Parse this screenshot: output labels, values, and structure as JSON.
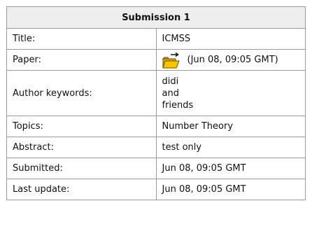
{
  "header": {
    "title": "Submission 1"
  },
  "rows": [
    {
      "label": "Title:",
      "value": "ICMSS"
    },
    {
      "label": "Paper:",
      "value": "(Jun 08, 09:05 GMT)",
      "icon": "folder-icon"
    },
    {
      "label": "Author keywords:",
      "value": [
        "didi",
        "and",
        "friends"
      ]
    },
    {
      "label": "Topics:",
      "value": "Number Theory"
    },
    {
      "label": "Abstract:",
      "value": "test only"
    },
    {
      "label": "Submitted:",
      "value": "Jun 08, 09:05 GMT"
    },
    {
      "label": "Last update:",
      "value": "Jun 08, 09:05 GMT"
    }
  ],
  "colors": {
    "border": "#9a9a9a",
    "header_bg": "#eeeeee",
    "folder_fill": "#f7c600"
  }
}
